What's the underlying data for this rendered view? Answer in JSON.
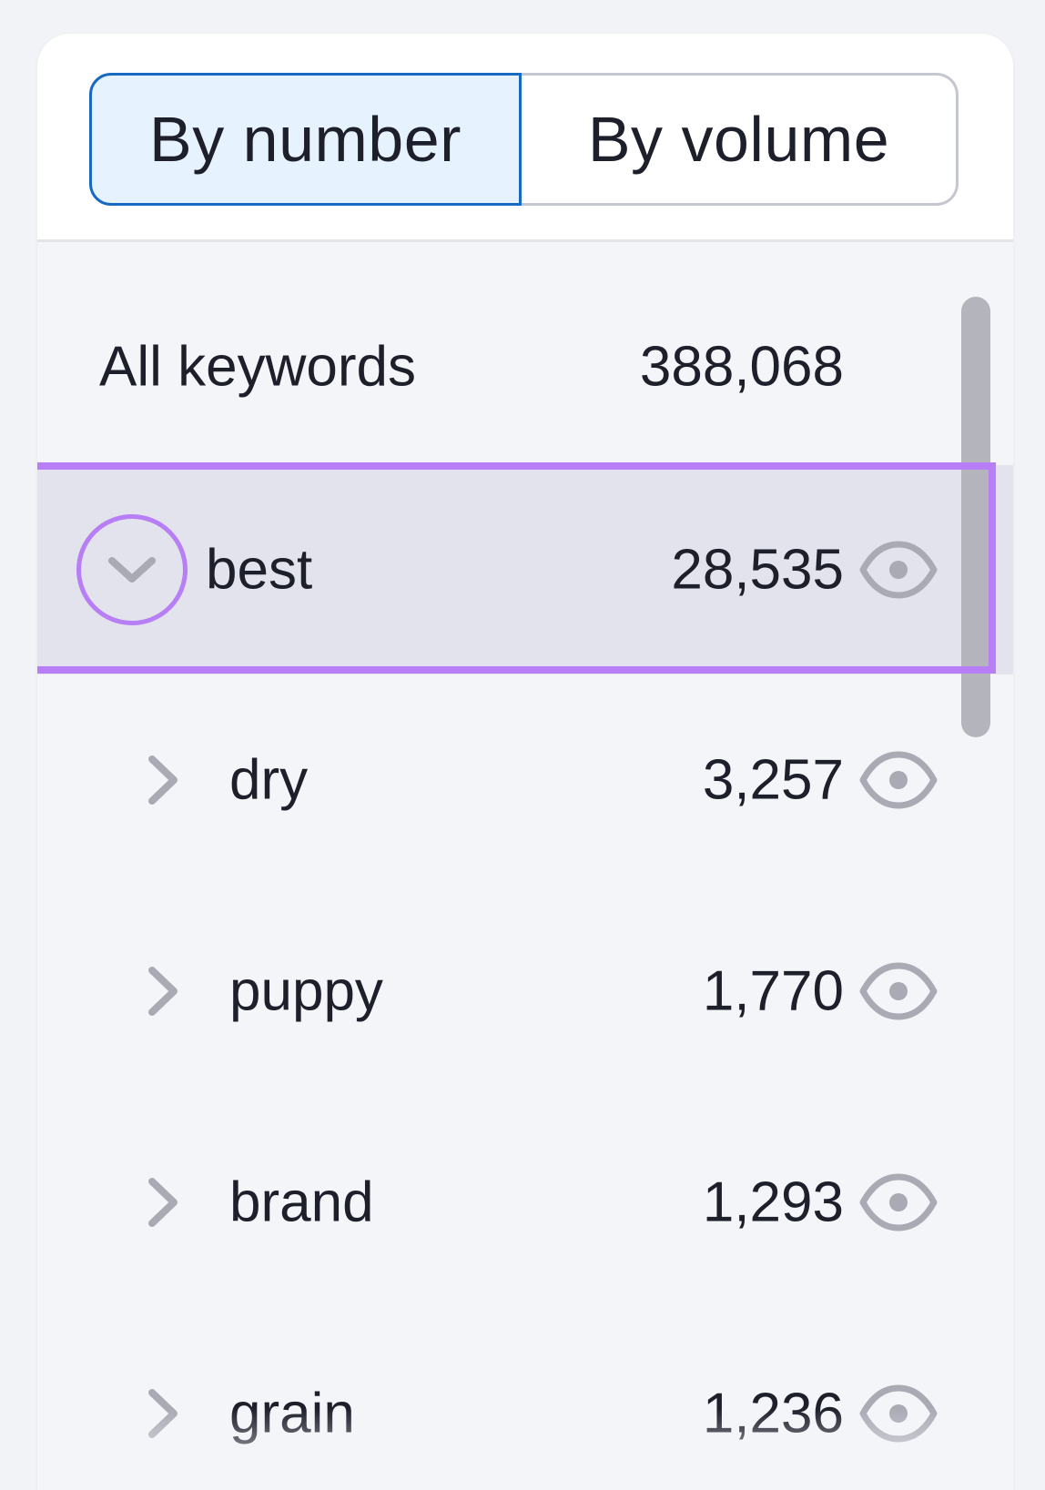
{
  "toggle": {
    "by_number": "By number",
    "by_volume": "By volume"
  },
  "all_keywords": {
    "label": "All keywords",
    "count": "388,068"
  },
  "groups": [
    {
      "label": "best",
      "count": "28,535",
      "expanded": true
    },
    {
      "label": "dry",
      "count": "3,257"
    },
    {
      "label": "puppy",
      "count": "1,770"
    },
    {
      "label": "brand",
      "count": "1,293"
    },
    {
      "label": "grain",
      "count": "1,236"
    }
  ],
  "colors": {
    "highlight": "#b77ef5",
    "active_tab_border": "#1769c2",
    "active_tab_bg": "#e6f3ff",
    "icon_gray": "#a9aab4"
  }
}
